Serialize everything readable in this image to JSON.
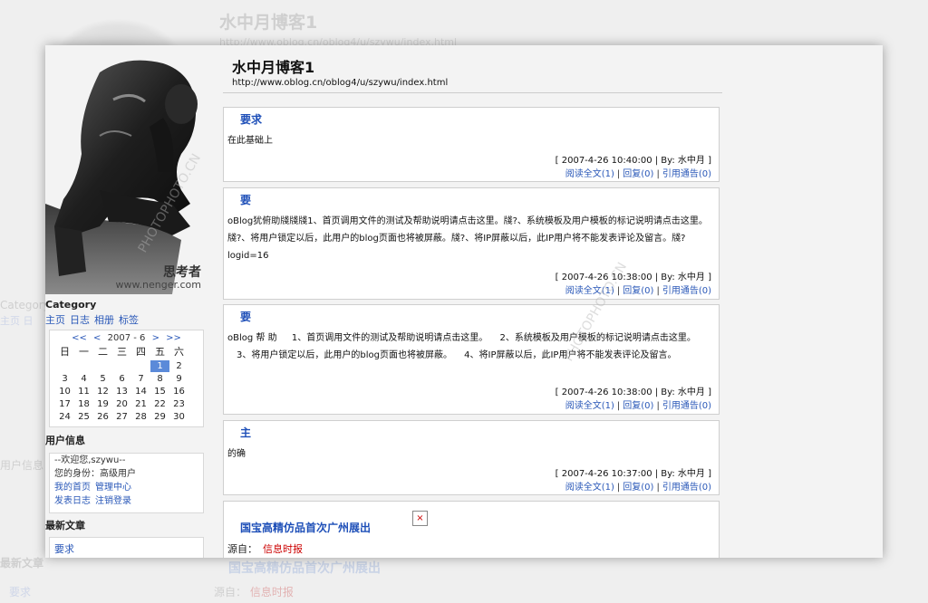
{
  "background": {
    "title": "水中月博客1",
    "url": "http://www.oblog.cn/oblog4/u/szywu/index.html",
    "category": "Category",
    "left_items": "主页  日",
    "user_label": "用户信息",
    "new_articles": "最新文章",
    "req": "要求",
    "news_title": "国宝高精仿品首次广州展出",
    "source_label": "源自：",
    "source_value": "信息时报"
  },
  "sidebar": {
    "caption_main": "思考者",
    "caption_url": "www.nenger.com",
    "category_label": "Category",
    "category_links": [
      "主页",
      "日志",
      "相册",
      "标签"
    ],
    "calendar": {
      "nav_prev_year": "<<",
      "nav_prev_month": "<",
      "month_label": "2007 - 6",
      "nav_next_month": ">",
      "nav_next_year": ">>",
      "weekdays": [
        "日",
        "一",
        "二",
        "三",
        "四",
        "五",
        "六"
      ],
      "days": [
        "",
        "",
        "",
        "",
        "",
        "1",
        "2",
        "3",
        "4",
        "5",
        "6",
        "7",
        "8",
        "9",
        "10",
        "11",
        "12",
        "13",
        "14",
        "15",
        "16",
        "17",
        "18",
        "19",
        "20",
        "21",
        "22",
        "23",
        "24",
        "25",
        "26",
        "27",
        "28",
        "29",
        "30"
      ],
      "highlight_day": "1"
    },
    "user_info_label": "用户信息",
    "user_info": {
      "welcome": "--欢迎您,szywu--",
      "identity": "您的身份：高级用户",
      "links_row1": [
        "我的首页",
        "管理中心"
      ],
      "links_row2": [
        "发表日志",
        "注销登录"
      ]
    },
    "new_articles_label": "最新文章",
    "new_articles": [
      "要求"
    ]
  },
  "main": {
    "blog_title": "水中月博客1",
    "blog_url": "http://www.oblog.cn/oblog4/u/szywu/index.html",
    "posts": [
      {
        "title": "要求",
        "body": "在此基础上",
        "meta": "[ 2007-4-26 10:40:00 | By: 水中月 ]",
        "read": "阅读全文(1)",
        "reply": "回复(0)",
        "trackback": "引用通告(0)"
      },
      {
        "title": "要",
        "body": "oBlog犹俯助牋牋牋1、首页调用文件的测试及帮助说明请点击这里。牋?、系统模板及用户模板的标记说明请点击这里。牋?、将用户锁定以后，此用户的blog页面也将被屏蔽。牋?、将IP屏蔽以后，此IP用户将不能发表评论及留言。牋?logid=16",
        "meta": "[ 2007-4-26 10:38:00 | By: 水中月 ]",
        "read": "阅读全文(1)",
        "reply": "回复(0)",
        "trackback": "引用通告(0)"
      },
      {
        "title": "要",
        "body": "oBlog 帮 助 　 1、首页调用文件的测试及帮助说明请点击这里。 　2、系统模板及用户模板的标记说明请点击这里。 　3、将用户锁定以后，此用户的blog页面也将被屏蔽。 　4、将IP屏蔽以后，此IP用户将不能发表评论及留言。",
        "meta": "[ 2007-4-26 10:38:00 | By: 水中月 ]",
        "read": "阅读全文(1)",
        "reply": "回复(0)",
        "trackback": "引用通告(0)"
      },
      {
        "title": "主",
        "body": "的确",
        "meta": "[ 2007-4-26 10:37:00 | By: 水中月 ]",
        "read": "阅读全文(1)",
        "reply": "回复(0)",
        "trackback": "引用通告(0)"
      }
    ],
    "news": {
      "title": "国宝高精仿品首次广州展出",
      "image_placeholder": "×",
      "source_label": "源自：",
      "source_value": "信息时报"
    }
  },
  "watermark": {
    "text": "PHOTOPHOTO.CN"
  }
}
